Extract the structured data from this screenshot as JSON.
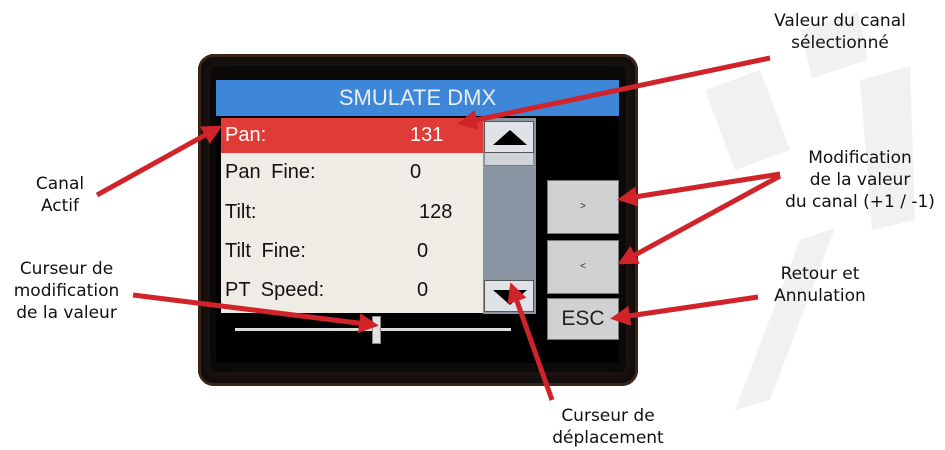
{
  "screen": {
    "title": "SMULATE DMX",
    "rows": [
      {
        "label": "Pan:",
        "value": "131",
        "selected": true
      },
      {
        "label": "Pan Fine:",
        "value": "0"
      },
      {
        "label": "Tilt:",
        "value": "128"
      },
      {
        "label": "Tilt Fine:",
        "value": "0"
      },
      {
        "label": "PT Speed:",
        "value": "0"
      }
    ],
    "buttons": {
      "increase": ">",
      "decrease": "<",
      "esc": "ESC"
    }
  },
  "annotations": {
    "selected_value": [
      "Valeur du canal",
      "sélectionné"
    ],
    "active_channel": [
      "Canal",
      "Actif"
    ],
    "value_change": [
      "Modification",
      "de la valeur",
      "du canal (+1 / -1)"
    ],
    "back_cancel": [
      "Retour et",
      "Annulation"
    ],
    "value_cursor": [
      "Curseur de",
      "modification",
      "de la valeur"
    ],
    "move_cursor": [
      "Curseur de",
      "déplacement"
    ]
  },
  "colors": {
    "title_bar": "#3d86d8",
    "selected_row": "#e03b37",
    "arrow": "#d0232a"
  }
}
